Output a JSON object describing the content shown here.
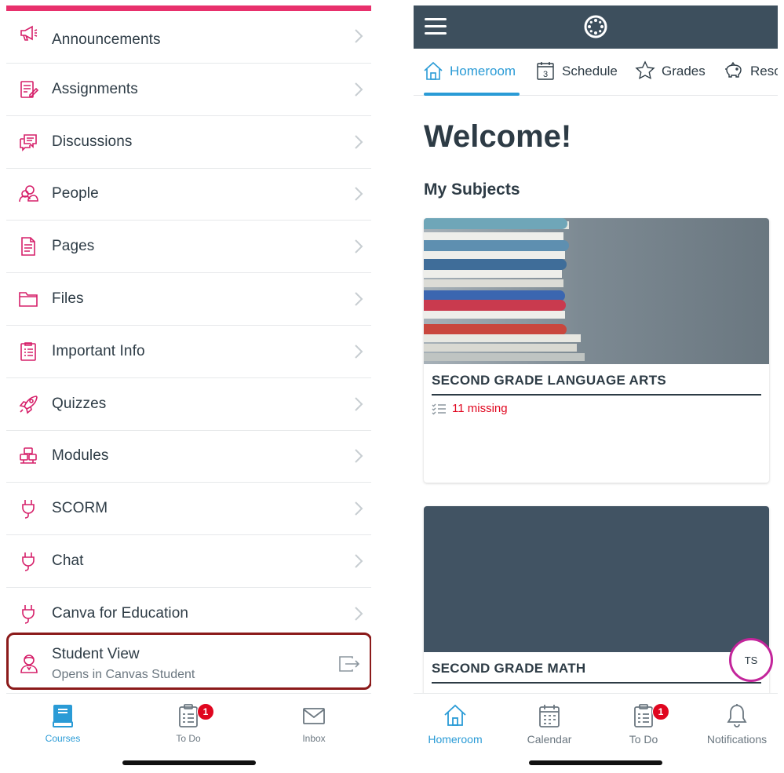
{
  "left": {
    "menu_items": [
      {
        "label": "Announcements",
        "icon": "megaphone-icon"
      },
      {
        "label": "Assignments",
        "icon": "assignment-icon"
      },
      {
        "label": "Discussions",
        "icon": "discussion-icon"
      },
      {
        "label": "People",
        "icon": "people-icon"
      },
      {
        "label": "Pages",
        "icon": "page-icon"
      },
      {
        "label": "Files",
        "icon": "folder-icon"
      },
      {
        "label": "Important Info",
        "icon": "syllabus-icon"
      },
      {
        "label": "Quizzes",
        "icon": "rocket-icon"
      },
      {
        "label": "Modules",
        "icon": "modules-icon"
      },
      {
        "label": "SCORM",
        "icon": "plug-icon"
      },
      {
        "label": "Chat",
        "icon": "plug-icon"
      },
      {
        "label": "Canva for Education",
        "icon": "plug-icon"
      }
    ],
    "student_view": {
      "title": "Student View",
      "subtitle": "Opens in Canvas Student"
    },
    "tabbar": {
      "courses": "Courses",
      "todo": "To Do",
      "todo_badge": "1",
      "inbox": "Inbox"
    }
  },
  "right": {
    "tabs": {
      "homeroom": "Homeroom",
      "schedule": "Schedule",
      "schedule_day": "3",
      "grades": "Grades",
      "resources": "Reso"
    },
    "welcome": "Welcome!",
    "my_subjects": "My Subjects",
    "cards": [
      {
        "title": "SECOND GRADE LANGUAGE ARTS",
        "missing": "11 missing"
      },
      {
        "title": "SECOND GRADE MATH"
      }
    ],
    "avatar_initials": "TS",
    "tabbar": {
      "homeroom": "Homeroom",
      "calendar": "Calendar",
      "todo": "To Do",
      "todo_badge": "1",
      "notifications": "Notifications"
    }
  },
  "colors": {
    "brand_pink": "#e8306c",
    "nav_dark": "#3d4f5d",
    "active_blue": "#2a9bd6",
    "highlight_border": "#8b1a1a",
    "missing_red": "#e0061f",
    "avatar_ring": "#c3259b"
  }
}
